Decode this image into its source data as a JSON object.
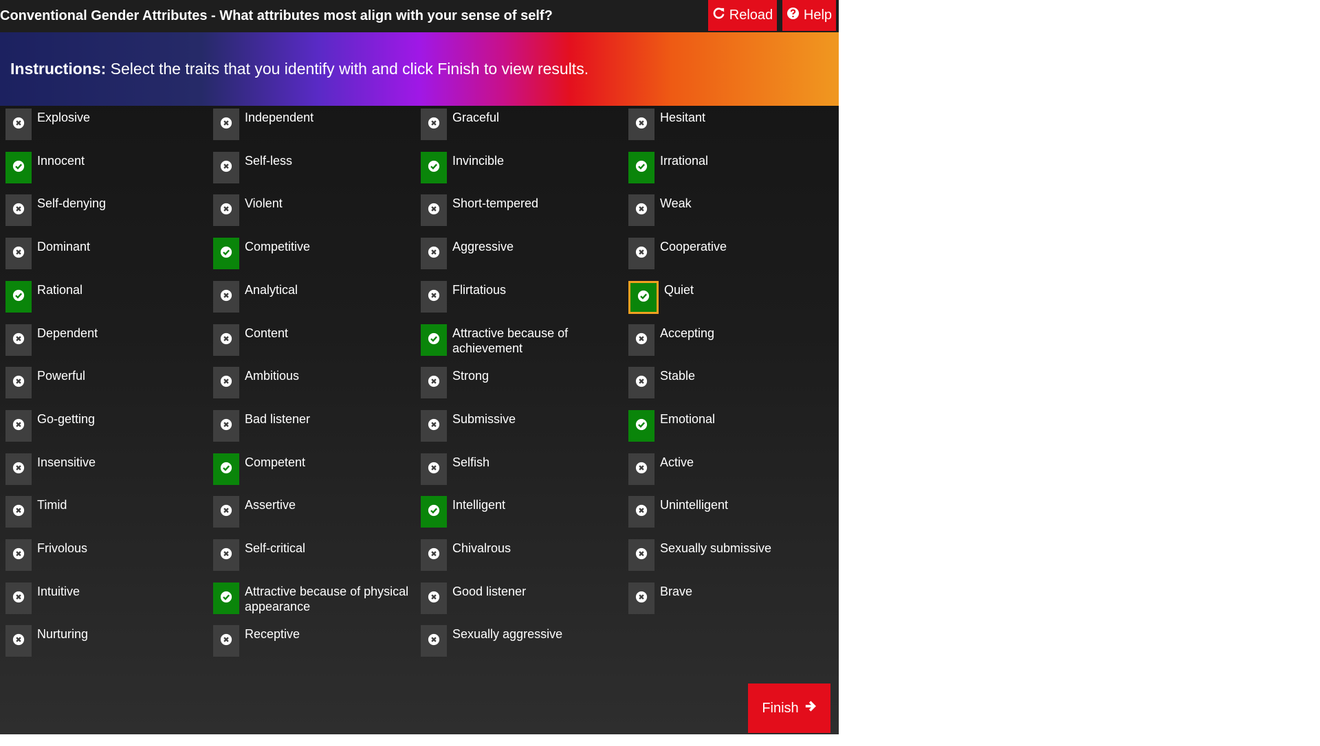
{
  "header": {
    "title": "Conventional Gender Attributes - What attributes most align with your sense of self?",
    "reload_label": "Reload",
    "help_label": "Help"
  },
  "banner": {
    "instructions_label": "Instructions:",
    "instructions_text": " Select the traits that you identify with and click Finish to view results."
  },
  "columns": [
    [
      {
        "label": "Explosive",
        "selected": false
      },
      {
        "label": "Innocent",
        "selected": true
      },
      {
        "label": "Self-denying",
        "selected": false
      },
      {
        "label": "Dominant",
        "selected": false
      },
      {
        "label": "Rational",
        "selected": true
      },
      {
        "label": "Dependent",
        "selected": false
      },
      {
        "label": "Powerful",
        "selected": false
      },
      {
        "label": "Go-getting",
        "selected": false
      },
      {
        "label": "Insensitive",
        "selected": false
      },
      {
        "label": "Timid",
        "selected": false
      },
      {
        "label": "Frivolous",
        "selected": false
      },
      {
        "label": "Intuitive",
        "selected": false
      },
      {
        "label": "Nurturing",
        "selected": false
      }
    ],
    [
      {
        "label": "Independent",
        "selected": false
      },
      {
        "label": "Self-less",
        "selected": false
      },
      {
        "label": "Violent",
        "selected": false
      },
      {
        "label": "Competitive",
        "selected": true
      },
      {
        "label": "Analytical",
        "selected": false
      },
      {
        "label": "Content",
        "selected": false
      },
      {
        "label": "Ambitious",
        "selected": false
      },
      {
        "label": "Bad listener",
        "selected": false
      },
      {
        "label": "Competent",
        "selected": true
      },
      {
        "label": "Assertive",
        "selected": false
      },
      {
        "label": "Self-critical",
        "selected": false
      },
      {
        "label": "Attractive because of physical appearance",
        "selected": true
      },
      {
        "label": "Receptive",
        "selected": false
      }
    ],
    [
      {
        "label": "Graceful",
        "selected": false
      },
      {
        "label": "Invincible",
        "selected": true
      },
      {
        "label": "Short-tempered",
        "selected": false
      },
      {
        "label": "Aggressive",
        "selected": false
      },
      {
        "label": "Flirtatious",
        "selected": false
      },
      {
        "label": "Attractive because of achievement",
        "selected": true
      },
      {
        "label": "Strong",
        "selected": false
      },
      {
        "label": "Submissive",
        "selected": false
      },
      {
        "label": "Selfish",
        "selected": false
      },
      {
        "label": "Intelligent",
        "selected": true
      },
      {
        "label": "Chivalrous",
        "selected": false
      },
      {
        "label": "Good listener",
        "selected": false
      },
      {
        "label": "Sexually aggressive",
        "selected": false
      }
    ],
    [
      {
        "label": "Hesitant",
        "selected": false
      },
      {
        "label": "Irrational",
        "selected": true
      },
      {
        "label": "Weak",
        "selected": false
      },
      {
        "label": "Cooperative",
        "selected": false
      },
      {
        "label": "Quiet",
        "selected": true,
        "focused": true
      },
      {
        "label": "Accepting",
        "selected": false
      },
      {
        "label": "Stable",
        "selected": false
      },
      {
        "label": "Emotional",
        "selected": true
      },
      {
        "label": "Active",
        "selected": false
      },
      {
        "label": "Unintelligent",
        "selected": false
      },
      {
        "label": "Sexually submissive",
        "selected": false
      },
      {
        "label": "Brave",
        "selected": false
      }
    ]
  ],
  "finish": {
    "label": "Finish"
  },
  "colors": {
    "selected": "#0a850a",
    "unselected": "#3f3f3f",
    "accent_red": "#e30d1b",
    "focus_ring": "#f0a020"
  }
}
